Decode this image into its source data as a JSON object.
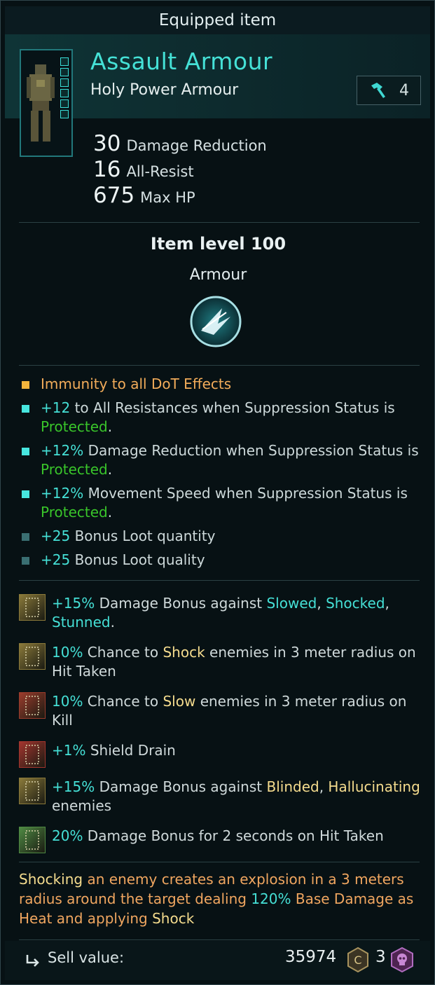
{
  "window": {
    "title": "Equipped item"
  },
  "item": {
    "name": "Assault Armour",
    "subtype": "Holy Power Armour",
    "tier_icon": "hammer-icon",
    "tier_value": "4",
    "stats": [
      {
        "value": "30",
        "label": "Damage Reduction"
      },
      {
        "value": "16",
        "label": "All-Resist"
      },
      {
        "value": "675",
        "label": "Max HP"
      }
    ],
    "item_level": "Item level 100",
    "category": "Armour",
    "category_icon": "armour-shard-icon"
  },
  "affixes": [
    {
      "bullet_color": "#f2b43c",
      "parts": [
        {
          "t": "Immunity to all DoT Effects",
          "c": "orange"
        }
      ]
    },
    {
      "bullet_color": "#47e6df",
      "parts": [
        {
          "t": "+12",
          "c": "cyan"
        },
        {
          "t": " to All Resistances when Suppression Status is "
        },
        {
          "t": "Protected",
          "c": "green"
        },
        {
          "t": "."
        }
      ]
    },
    {
      "bullet_color": "#47e6df",
      "parts": [
        {
          "t": "+12%",
          "c": "cyan"
        },
        {
          "t": " Damage Reduction when Suppression Status is "
        },
        {
          "t": "Protected",
          "c": "green"
        },
        {
          "t": "."
        }
      ]
    },
    {
      "bullet_color": "#47e6df",
      "parts": [
        {
          "t": "+12%",
          "c": "cyan"
        },
        {
          "t": " Movement Speed when Suppression Status is "
        },
        {
          "t": "Protected",
          "c": "green"
        },
        {
          "t": "."
        }
      ]
    },
    {
      "bullet_color": "#3a6f72",
      "parts": [
        {
          "t": "+25",
          "c": "cyan"
        },
        {
          "t": " Bonus Loot quantity"
        }
      ]
    },
    {
      "bullet_color": "#3a6f72",
      "parts": [
        {
          "t": "+25",
          "c": "cyan"
        },
        {
          "t": " Bonus Loot quality"
        }
      ]
    }
  ],
  "mods": [
    {
      "rune_color": "#8b7a3a",
      "rune_icon": "rune-m-icon",
      "parts": [
        {
          "t": "+15%",
          "c": "cyan"
        },
        {
          "t": " Damage Bonus against "
        },
        {
          "t": "Slowed",
          "c": "cyan"
        },
        {
          "t": ", "
        },
        {
          "t": "Shocked",
          "c": "cyan"
        },
        {
          "t": ", "
        },
        {
          "t": "Stunned",
          "c": "cyan"
        },
        {
          "t": "."
        }
      ]
    },
    {
      "rune_color": "#8b7a3a",
      "rune_icon": "rune-b-icon",
      "parts": [
        {
          "t": "10%",
          "c": "cyan"
        },
        {
          "t": " Chance to "
        },
        {
          "t": "Shock",
          "c": "yellow"
        },
        {
          "t": " enemies in 3 meter radius on Hit Taken"
        }
      ]
    },
    {
      "rune_color": "#9b3c2c",
      "rune_icon": "rune-n-icon",
      "parts": [
        {
          "t": "10%",
          "c": "cyan"
        },
        {
          "t": " Chance to "
        },
        {
          "t": "Slow",
          "c": "yellow"
        },
        {
          "t": " enemies in 3 meter radius on Kill"
        }
      ]
    },
    {
      "rune_color": "#a3352e",
      "rune_icon": "rune-q-icon",
      "parts": [
        {
          "t": "+1%",
          "c": "cyan"
        },
        {
          "t": " Shield Drain"
        }
      ]
    },
    {
      "rune_color": "#8b7a3a",
      "rune_icon": "rune-n-icon",
      "parts": [
        {
          "t": "+15%",
          "c": "cyan"
        },
        {
          "t": " Damage Bonus against "
        },
        {
          "t": "Blinded",
          "c": "yellow"
        },
        {
          "t": ", "
        },
        {
          "t": "Hallucinating",
          "c": "yellow"
        },
        {
          "t": " enemies"
        }
      ]
    },
    {
      "rune_color": "#4f8a43",
      "rune_icon": "rune-t-icon",
      "parts": [
        {
          "t": "20%",
          "c": "cyan"
        },
        {
          "t": " Damage Bonus for 2 seconds on Hit Taken"
        }
      ]
    }
  ],
  "legendary": [
    {
      "t": "Shocking",
      "c": "yellow"
    },
    {
      "t": " an enemy creates an explosion in a 3 meters radius around the target dealing "
    },
    {
      "t": "120%",
      "c": "cyan"
    },
    {
      "t": " Base Damage as Heat and applying "
    },
    {
      "t": "Shock",
      "c": "yellow"
    }
  ],
  "footer": {
    "sell_label": "Sell value:",
    "sell_icon": "return-arrow-icon",
    "coins": "35974",
    "coin_icon": "credit-coin-icon",
    "skulls": "3",
    "skull_icon": "skull-currency-icon"
  },
  "colors": {
    "cyan": "#45e0d6",
    "green": "#39c52a",
    "orange": "#f2ac5a",
    "yellow": "#f5dc8e"
  }
}
